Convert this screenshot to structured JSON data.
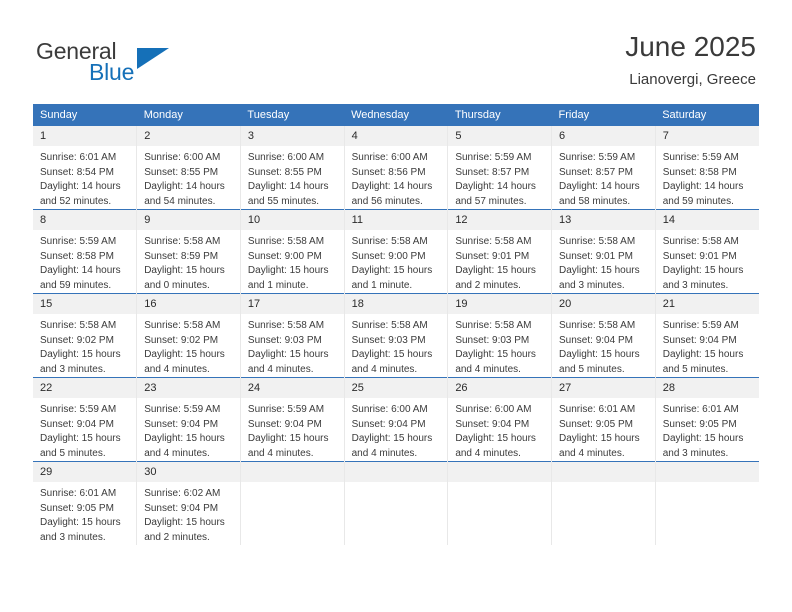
{
  "brand": {
    "name_part1": "General",
    "name_part2": "Blue",
    "triangle_icon": "triangle-icon",
    "accent_color": "#1570b8"
  },
  "header": {
    "title": "June 2025",
    "location": "Lianovergi, Greece"
  },
  "theme": {
    "header_bg": "#3573b9",
    "daynum_bg": "#f1f1f1",
    "row_divider": "#3573b9",
    "text": "#3b3b3b"
  },
  "calendar": {
    "weekdays": [
      "Sunday",
      "Monday",
      "Tuesday",
      "Wednesday",
      "Thursday",
      "Friday",
      "Saturday"
    ],
    "weeks": [
      [
        {
          "day": "1",
          "sunrise": "Sunrise: 6:01 AM",
          "sunset": "Sunset: 8:54 PM",
          "daylight": "Daylight: 14 hours and 52 minutes."
        },
        {
          "day": "2",
          "sunrise": "Sunrise: 6:00 AM",
          "sunset": "Sunset: 8:55 PM",
          "daylight": "Daylight: 14 hours and 54 minutes."
        },
        {
          "day": "3",
          "sunrise": "Sunrise: 6:00 AM",
          "sunset": "Sunset: 8:55 PM",
          "daylight": "Daylight: 14 hours and 55 minutes."
        },
        {
          "day": "4",
          "sunrise": "Sunrise: 6:00 AM",
          "sunset": "Sunset: 8:56 PM",
          "daylight": "Daylight: 14 hours and 56 minutes."
        },
        {
          "day": "5",
          "sunrise": "Sunrise: 5:59 AM",
          "sunset": "Sunset: 8:57 PM",
          "daylight": "Daylight: 14 hours and 57 minutes."
        },
        {
          "day": "6",
          "sunrise": "Sunrise: 5:59 AM",
          "sunset": "Sunset: 8:57 PM",
          "daylight": "Daylight: 14 hours and 58 minutes."
        },
        {
          "day": "7",
          "sunrise": "Sunrise: 5:59 AM",
          "sunset": "Sunset: 8:58 PM",
          "daylight": "Daylight: 14 hours and 59 minutes."
        }
      ],
      [
        {
          "day": "8",
          "sunrise": "Sunrise: 5:59 AM",
          "sunset": "Sunset: 8:58 PM",
          "daylight": "Daylight: 14 hours and 59 minutes."
        },
        {
          "day": "9",
          "sunrise": "Sunrise: 5:58 AM",
          "sunset": "Sunset: 8:59 PM",
          "daylight": "Daylight: 15 hours and 0 minutes."
        },
        {
          "day": "10",
          "sunrise": "Sunrise: 5:58 AM",
          "sunset": "Sunset: 9:00 PM",
          "daylight": "Daylight: 15 hours and 1 minute."
        },
        {
          "day": "11",
          "sunrise": "Sunrise: 5:58 AM",
          "sunset": "Sunset: 9:00 PM",
          "daylight": "Daylight: 15 hours and 1 minute."
        },
        {
          "day": "12",
          "sunrise": "Sunrise: 5:58 AM",
          "sunset": "Sunset: 9:01 PM",
          "daylight": "Daylight: 15 hours and 2 minutes."
        },
        {
          "day": "13",
          "sunrise": "Sunrise: 5:58 AM",
          "sunset": "Sunset: 9:01 PM",
          "daylight": "Daylight: 15 hours and 3 minutes."
        },
        {
          "day": "14",
          "sunrise": "Sunrise: 5:58 AM",
          "sunset": "Sunset: 9:01 PM",
          "daylight": "Daylight: 15 hours and 3 minutes."
        }
      ],
      [
        {
          "day": "15",
          "sunrise": "Sunrise: 5:58 AM",
          "sunset": "Sunset: 9:02 PM",
          "daylight": "Daylight: 15 hours and 3 minutes."
        },
        {
          "day": "16",
          "sunrise": "Sunrise: 5:58 AM",
          "sunset": "Sunset: 9:02 PM",
          "daylight": "Daylight: 15 hours and 4 minutes."
        },
        {
          "day": "17",
          "sunrise": "Sunrise: 5:58 AM",
          "sunset": "Sunset: 9:03 PM",
          "daylight": "Daylight: 15 hours and 4 minutes."
        },
        {
          "day": "18",
          "sunrise": "Sunrise: 5:58 AM",
          "sunset": "Sunset: 9:03 PM",
          "daylight": "Daylight: 15 hours and 4 minutes."
        },
        {
          "day": "19",
          "sunrise": "Sunrise: 5:58 AM",
          "sunset": "Sunset: 9:03 PM",
          "daylight": "Daylight: 15 hours and 4 minutes."
        },
        {
          "day": "20",
          "sunrise": "Sunrise: 5:58 AM",
          "sunset": "Sunset: 9:04 PM",
          "daylight": "Daylight: 15 hours and 5 minutes."
        },
        {
          "day": "21",
          "sunrise": "Sunrise: 5:59 AM",
          "sunset": "Sunset: 9:04 PM",
          "daylight": "Daylight: 15 hours and 5 minutes."
        }
      ],
      [
        {
          "day": "22",
          "sunrise": "Sunrise: 5:59 AM",
          "sunset": "Sunset: 9:04 PM",
          "daylight": "Daylight: 15 hours and 5 minutes."
        },
        {
          "day": "23",
          "sunrise": "Sunrise: 5:59 AM",
          "sunset": "Sunset: 9:04 PM",
          "daylight": "Daylight: 15 hours and 4 minutes."
        },
        {
          "day": "24",
          "sunrise": "Sunrise: 5:59 AM",
          "sunset": "Sunset: 9:04 PM",
          "daylight": "Daylight: 15 hours and 4 minutes."
        },
        {
          "day": "25",
          "sunrise": "Sunrise: 6:00 AM",
          "sunset": "Sunset: 9:04 PM",
          "daylight": "Daylight: 15 hours and 4 minutes."
        },
        {
          "day": "26",
          "sunrise": "Sunrise: 6:00 AM",
          "sunset": "Sunset: 9:04 PM",
          "daylight": "Daylight: 15 hours and 4 minutes."
        },
        {
          "day": "27",
          "sunrise": "Sunrise: 6:01 AM",
          "sunset": "Sunset: 9:05 PM",
          "daylight": "Daylight: 15 hours and 4 minutes."
        },
        {
          "day": "28",
          "sunrise": "Sunrise: 6:01 AM",
          "sunset": "Sunset: 9:05 PM",
          "daylight": "Daylight: 15 hours and 3 minutes."
        }
      ],
      [
        {
          "day": "29",
          "sunrise": "Sunrise: 6:01 AM",
          "sunset": "Sunset: 9:05 PM",
          "daylight": "Daylight: 15 hours and 3 minutes."
        },
        {
          "day": "30",
          "sunrise": "Sunrise: 6:02 AM",
          "sunset": "Sunset: 9:04 PM",
          "daylight": "Daylight: 15 hours and 2 minutes."
        },
        {
          "day": "",
          "sunrise": "",
          "sunset": "",
          "daylight": ""
        },
        {
          "day": "",
          "sunrise": "",
          "sunset": "",
          "daylight": ""
        },
        {
          "day": "",
          "sunrise": "",
          "sunset": "",
          "daylight": ""
        },
        {
          "day": "",
          "sunrise": "",
          "sunset": "",
          "daylight": ""
        },
        {
          "day": "",
          "sunrise": "",
          "sunset": "",
          "daylight": ""
        }
      ]
    ]
  }
}
